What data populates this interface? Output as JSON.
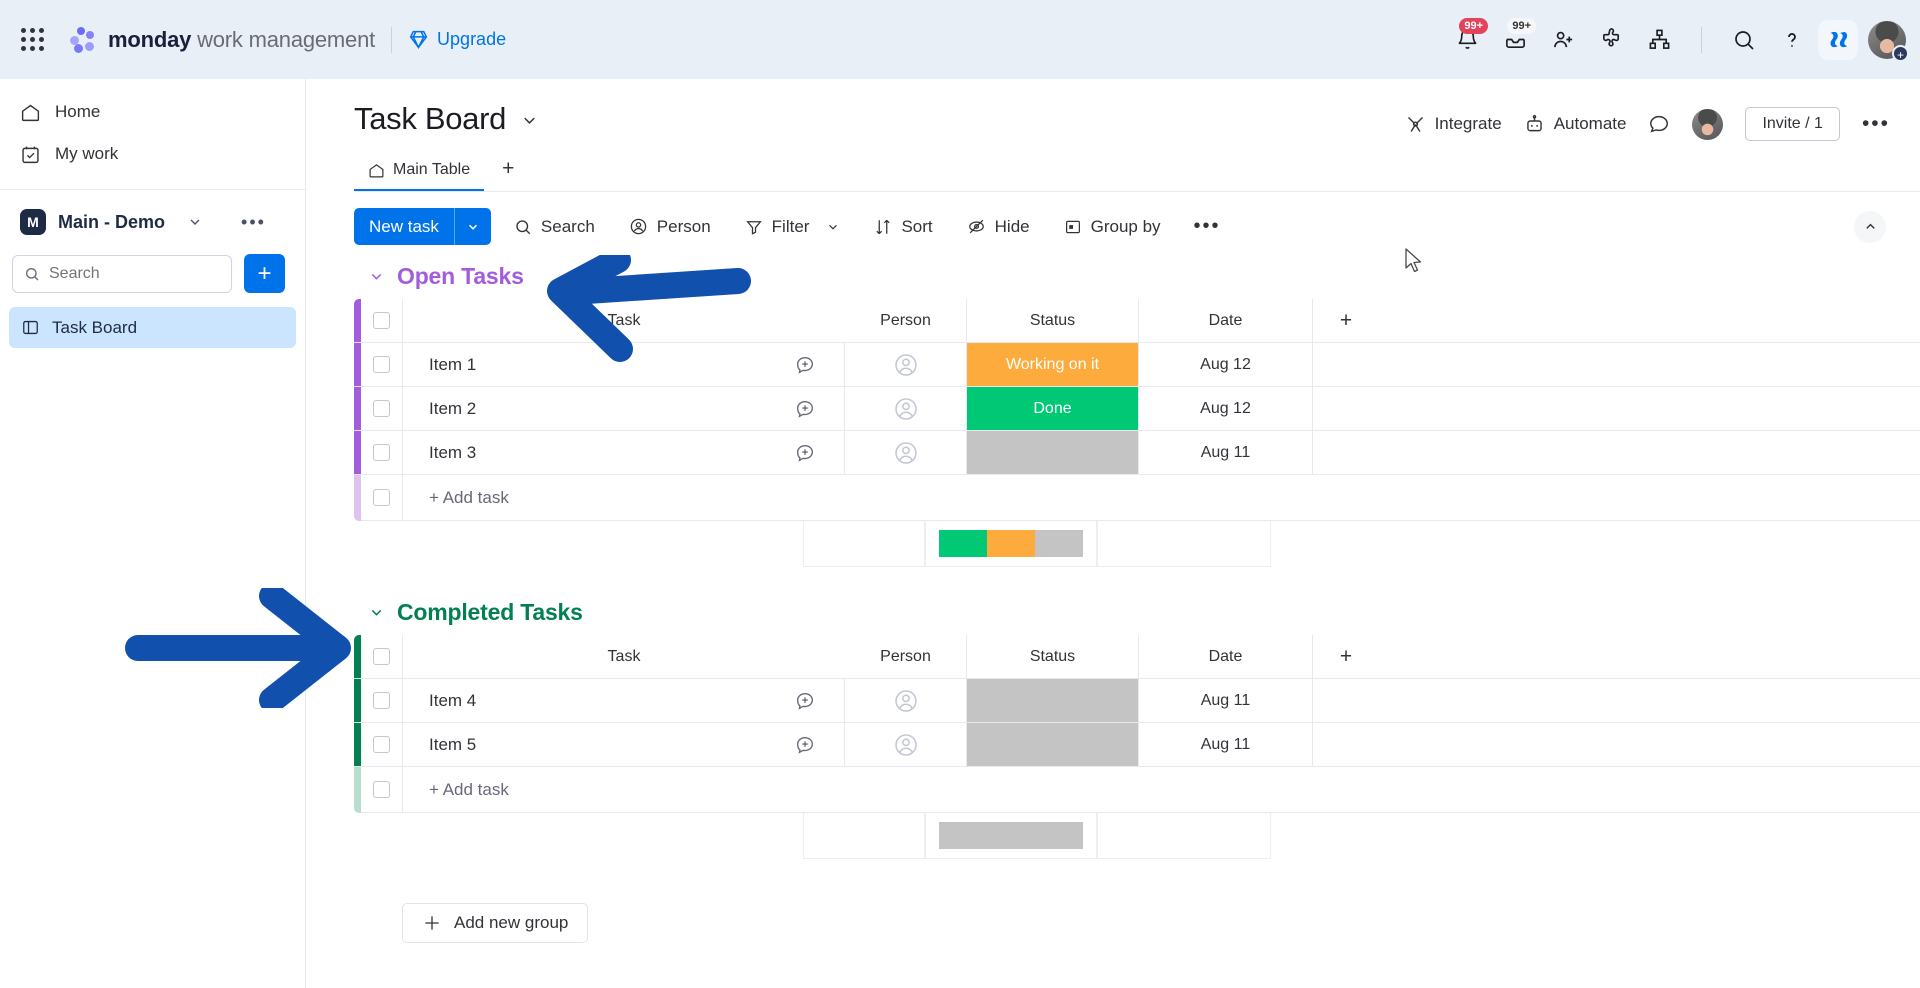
{
  "topbar": {
    "apps_icon": "apps-grid-icon",
    "brand_bold": "monday",
    "brand_rest": " work management",
    "upgrade_label": "Upgrade",
    "upgrade_icon": "diamond-icon",
    "notifications_badge": "99+",
    "inbox_badge": "99+",
    "icons": [
      {
        "name": "notifications-bell-icon"
      },
      {
        "name": "inbox-icon"
      },
      {
        "name": "invite-member-icon"
      },
      {
        "name": "apps-marketplace-icon"
      },
      {
        "name": "org-chart-icon"
      },
      {
        "name": "search-icon"
      },
      {
        "name": "help-icon"
      },
      {
        "name": "monday-ai-icon"
      }
    ],
    "avatar_plus": "+"
  },
  "sidebar": {
    "items": [
      {
        "label": "Home",
        "icon": "home-icon"
      },
      {
        "label": "My work",
        "icon": "my-work-calendar-icon"
      }
    ],
    "workspace": {
      "initial": "M",
      "name": "Main - Demo",
      "chevron": "chevron-down-icon",
      "dots": "•••"
    },
    "search_placeholder": "Search",
    "add_button": "+",
    "boards": [
      {
        "label": "Task Board",
        "icon": "board-icon",
        "selected": true
      }
    ]
  },
  "board": {
    "title": "Task Board",
    "title_chevron": "chevron-down-icon",
    "tabs": [
      {
        "label": "Main Table",
        "icon": "home-icon",
        "active": true
      }
    ],
    "tab_add": "+",
    "header_actions": [
      {
        "label": "Integrate",
        "icon": "integrate-icon"
      },
      {
        "label": "Automate",
        "icon": "automate-robot-icon"
      }
    ],
    "activity_icon": "activity-chat-icon",
    "invite_label": "Invite / 1",
    "more_dots": "•••"
  },
  "toolbar": {
    "new_task_label": "New task",
    "new_task_chevron": "chevron-down-icon",
    "items": [
      {
        "label": "Search",
        "icon": "search-icon"
      },
      {
        "label": "Person",
        "icon": "person-icon"
      },
      {
        "label": "Filter",
        "icon": "filter-icon",
        "chevron": "chevron-down-icon"
      },
      {
        "label": "Sort",
        "icon": "sort-icon"
      },
      {
        "label": "Hide",
        "icon": "hide-eye-icon"
      },
      {
        "label": "Group by",
        "icon": "group-by-icon"
      }
    ],
    "more_dots": "•••",
    "collapse_icon": "chevron-up-icon"
  },
  "columns": {
    "task": "Task",
    "person": "Person",
    "status": "Status",
    "date": "Date",
    "add_column": "+"
  },
  "groups": [
    {
      "name": "Open Tasks",
      "color": "#a25ddc",
      "collapse_icon": "chevron-down-icon",
      "rows": [
        {
          "task": "Item 1",
          "person": "",
          "status": "Working on it",
          "status_color": "#fdab3d",
          "date": "Aug 12"
        },
        {
          "task": "Item 2",
          "person": "",
          "status": "Done",
          "status_color": "#00c875",
          "date": "Aug 12"
        },
        {
          "task": "Item 3",
          "person": "",
          "status": "",
          "status_color": "#c4c4c4",
          "date": "Aug 11"
        }
      ],
      "add_task_label": "+ Add task",
      "summary_segments": [
        {
          "color": "#00c875",
          "pct": 33.3
        },
        {
          "color": "#fdab3d",
          "pct": 33.4
        },
        {
          "color": "#c4c4c4",
          "pct": 33.3
        }
      ]
    },
    {
      "name": "Completed Tasks",
      "color": "#038051",
      "collapse_icon": "chevron-down-icon",
      "rows": [
        {
          "task": "Item 4",
          "person": "",
          "status": "",
          "status_color": "#c4c4c4",
          "date": "Aug 11"
        },
        {
          "task": "Item 5",
          "person": "",
          "status": "",
          "status_color": "#c4c4c4",
          "date": "Aug 11"
        }
      ],
      "add_task_label": "+ Add task",
      "summary_segments": [
        {
          "color": "#c4c4c4",
          "pct": 100
        }
      ]
    }
  ],
  "footer": {
    "add_group_label": "Add new group",
    "add_group_icon": "plus-icon"
  },
  "annotations": {
    "arrow_color": "#1250ae",
    "arrow_1": "arrow-pointing-left-at-open-tasks",
    "arrow_2": "arrow-pointing-right-at-completed-tasks",
    "cursor": "mouse-pointer"
  }
}
